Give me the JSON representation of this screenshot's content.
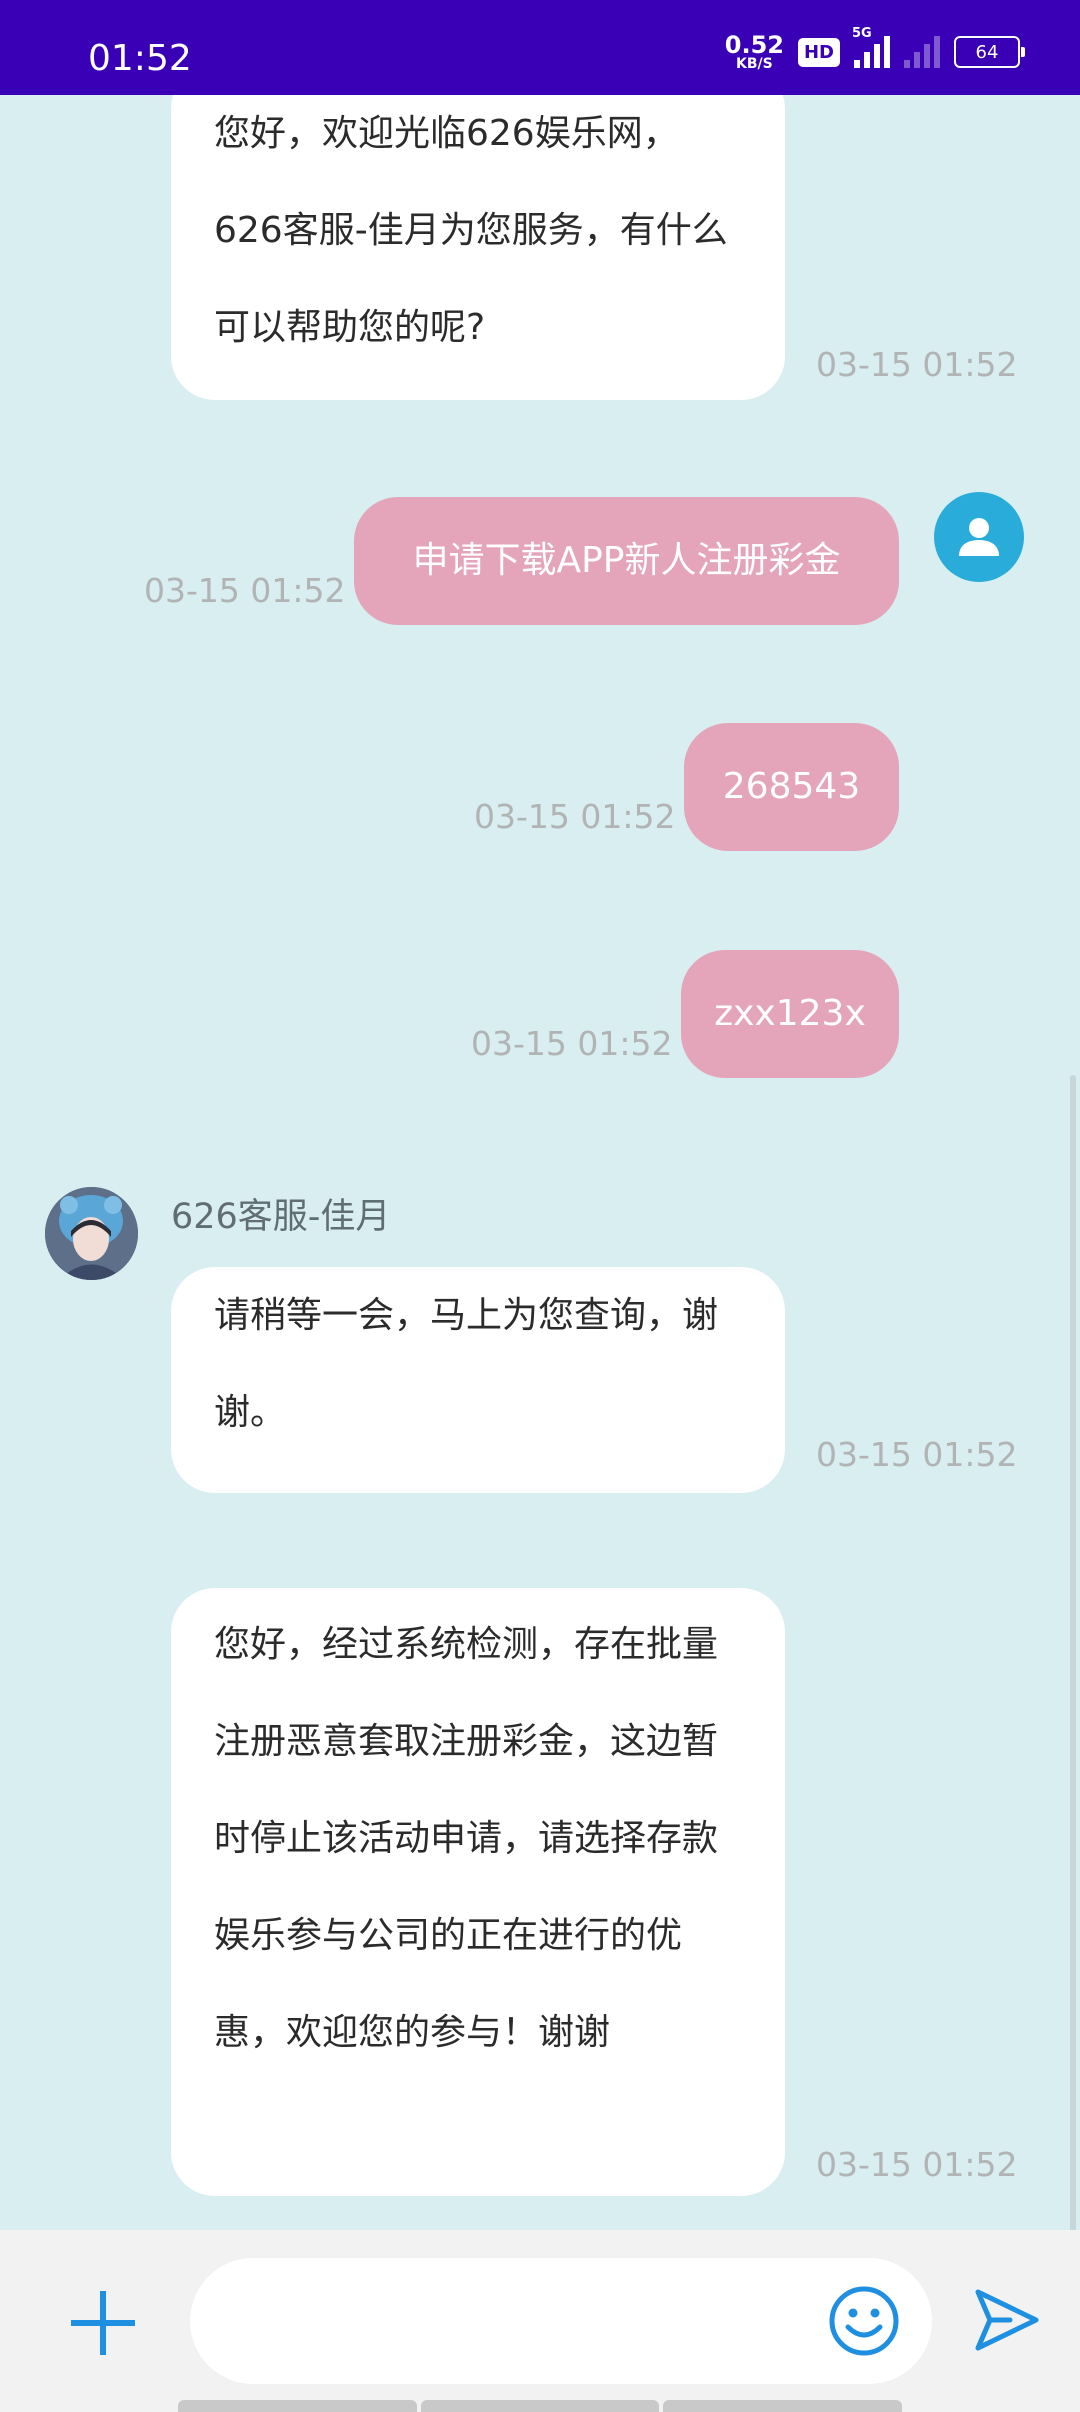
{
  "status_bar": {
    "time": "01:52",
    "speed_value": "0.52",
    "speed_unit": "KB/S",
    "hd_label": "HD",
    "network_label": "5G",
    "battery": "64"
  },
  "chat": {
    "agent_name": "626客服-佳月",
    "messages": [
      {
        "from": "agent",
        "text": "您好，欢迎光临626娱乐网，626客服-佳月为您服务，有什么可以帮助您的呢?",
        "time": "03-15 01:52"
      },
      {
        "from": "user",
        "text": "申请下载APP新人注册彩金",
        "time": "03-15 01:52"
      },
      {
        "from": "user",
        "text": "268543",
        "time": "03-15 01:52"
      },
      {
        "from": "user",
        "text": "zxx123x",
        "time": "03-15 01:52"
      },
      {
        "from": "agent",
        "text": "请稍等一会，马上为您查询，谢谢。",
        "time": "03-15 01:52"
      },
      {
        "from": "agent",
        "text": "您好，经过系统检测，存在批量注册恶意套取注册彩金，这边暂时停止该活动申请，请选择存款娱乐参与公司的正在进行的优惠，欢迎您的参与！谢谢",
        "time": "03-15 01:52"
      }
    ]
  },
  "composer": {
    "placeholder": "",
    "add_icon": "plus-icon",
    "emoji_icon": "smiley-icon",
    "send_icon": "send-icon"
  },
  "colors": {
    "status_bar": "#3a00b5",
    "chat_bg": "#d9eef0",
    "user_bubble": "#e4a4b9",
    "agent_bubble": "#ffffff",
    "accent": "#1e8fe1"
  }
}
